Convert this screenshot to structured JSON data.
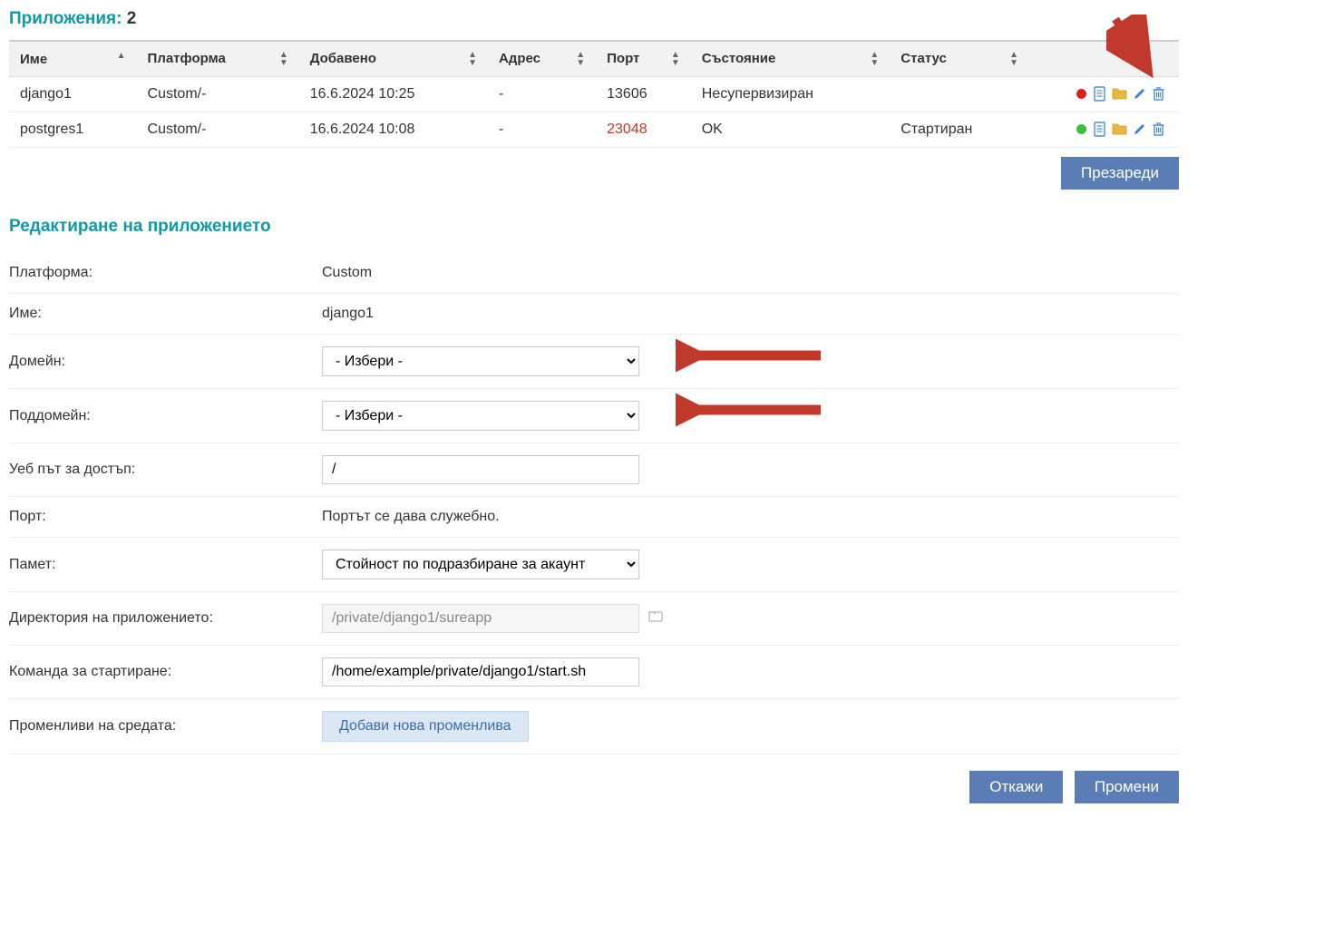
{
  "apps_section": {
    "title_label": "Приложения:",
    "count": "2"
  },
  "table": {
    "headers": {
      "name": "Име",
      "platform": "Платформа",
      "added": "Добавено",
      "address": "Адрес",
      "port": "Порт",
      "state": "Състояние",
      "status": "Статус"
    },
    "rows": [
      {
        "name": "django1",
        "platform": "Custom/-",
        "added": "16.6.2024 10:25",
        "address": "-",
        "port": "13606",
        "port_red": false,
        "state": "Несупервизиран",
        "status": "",
        "dot": "red"
      },
      {
        "name": "postgres1",
        "platform": "Custom/-",
        "added": "16.6.2024 10:08",
        "address": "-",
        "port": "23048",
        "port_red": true,
        "state": "OK",
        "status": "Стартиран",
        "dot": "green"
      }
    ]
  },
  "reload_btn": "Презареди",
  "edit_title": "Редактиране на приложението",
  "form": {
    "platform_label": "Платформа:",
    "platform_value": "Custom",
    "name_label": "Име:",
    "name_value": "django1",
    "domain_label": "Домейн:",
    "domain_selected": "- Избери -",
    "subdomain_label": "Поддомейн:",
    "subdomain_selected": "- Избери -",
    "webpath_label": "Уеб път за достъп:",
    "webpath_value": "/",
    "port_label": "Порт:",
    "port_value": "Портът се дава служебно.",
    "memory_label": "Памет:",
    "memory_selected": "Стойност по подразбиране за акаунт",
    "dir_label": "Директория на приложението:",
    "dir_value": "/private/django1/sureapp",
    "startcmd_label": "Команда за стартиране:",
    "startcmd_value": "/home/example/private/django1/start.sh",
    "envvars_label": "Променливи на средата:",
    "addvar_btn": "Добави нова променлива"
  },
  "footer_buttons": {
    "cancel": "Откажи",
    "save": "Промени"
  }
}
